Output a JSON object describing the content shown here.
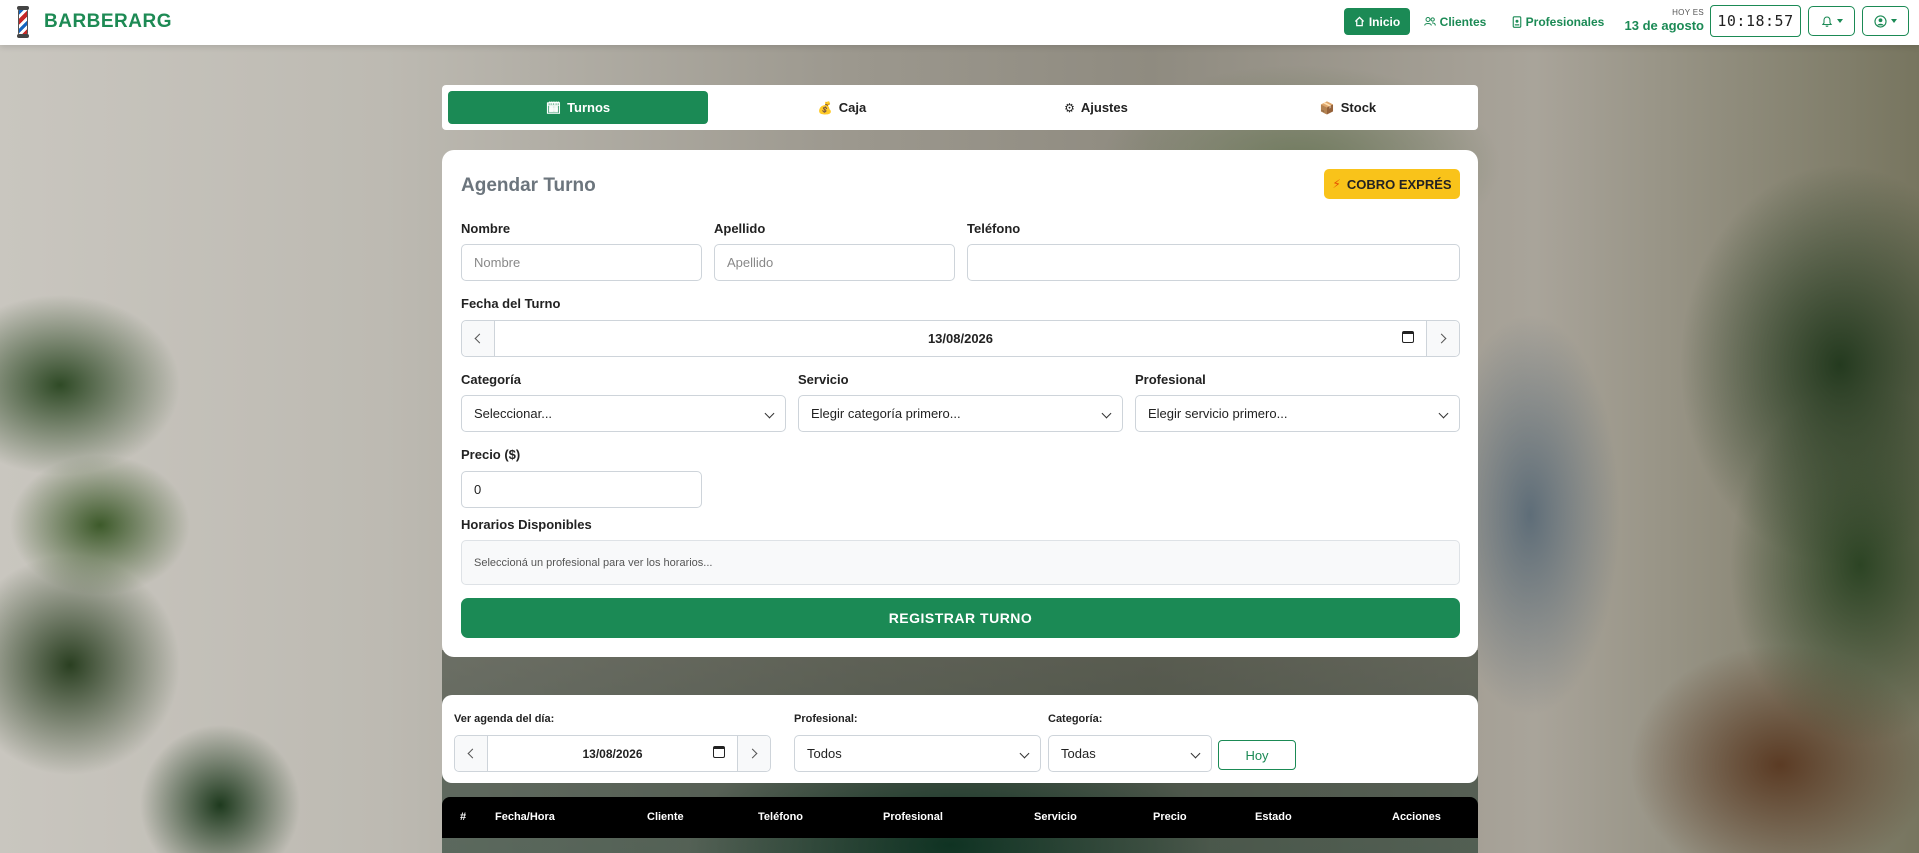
{
  "navbar": {
    "brand": "BARBERARG",
    "links": [
      {
        "label": "Inicio",
        "icon": "home-icon",
        "active": true
      },
      {
        "label": "Clientes",
        "icon": "users-icon"
      },
      {
        "label": "Profesionales",
        "icon": "id-badge-icon"
      }
    ],
    "today_label": "HOY ES",
    "today_date": "13 de agosto",
    "clock": "10:18:57",
    "accent_color": "#1b8a55"
  },
  "tabs": [
    {
      "label": "Turnos",
      "icon": "calendar-icon",
      "active": true
    },
    {
      "label": "Caja",
      "icon": "money-bag-icon"
    },
    {
      "label": "Ajustes",
      "icon": "gear-icon"
    },
    {
      "label": "Stock",
      "icon": "box-icon"
    }
  ],
  "form": {
    "title": "Agendar Turno",
    "express_button": "COBRO EXPRÉS",
    "nombre": {
      "label": "Nombre",
      "placeholder": "Nombre",
      "value": ""
    },
    "apellido": {
      "label": "Apellido",
      "placeholder": "Apellido",
      "value": ""
    },
    "telefono": {
      "label": "Teléfono",
      "value": ""
    },
    "fecha": {
      "label": "Fecha del Turno",
      "value": "13/08/2026"
    },
    "categoria": {
      "label": "Categoría",
      "value": "Seleccionar..."
    },
    "servicio": {
      "label": "Servicio",
      "value": "Elegir categoría primero..."
    },
    "profesional": {
      "label": "Profesional",
      "value": "Elegir servicio primero..."
    },
    "precio": {
      "label": "Precio ($)",
      "value": "0"
    },
    "horarios": {
      "label": "Horarios Disponibles",
      "message": "Seleccioná un profesional para ver los horarios..."
    },
    "submit": "REGISTRAR TURNO"
  },
  "agenda_filter": {
    "date_label": "Ver agenda del día:",
    "date_value": "13/08/2026",
    "profesional_label": "Profesional:",
    "profesional_value": "Todos",
    "categoria_label": "Categoría:",
    "categoria_value": "Todas",
    "today_button": "Hoy"
  },
  "table": {
    "columns": [
      "#",
      "Fecha/Hora",
      "Cliente",
      "Teléfono",
      "Profesional",
      "Servicio",
      "Precio",
      "Estado",
      "Acciones"
    ]
  }
}
